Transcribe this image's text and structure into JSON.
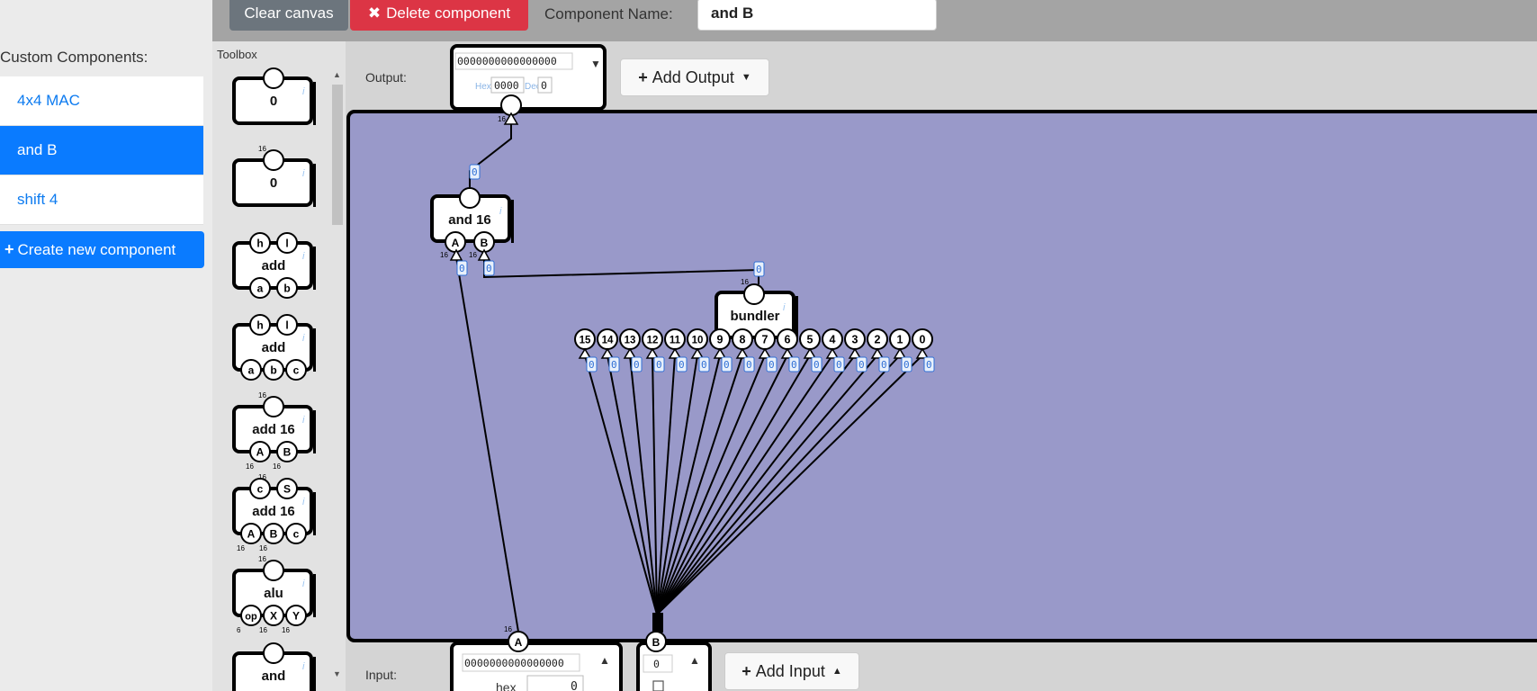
{
  "toolbar": {
    "clear_label": "Clear canvas",
    "delete_label": "Delete component",
    "delete_icon": "✖",
    "name_label": "Component Name:",
    "name_value": "and B"
  },
  "sidebar": {
    "title": "Custom Components:",
    "items": [
      {
        "label": "4x4 MAC",
        "active": false
      },
      {
        "label": "and B",
        "active": true
      },
      {
        "label": "shift 4",
        "active": false
      }
    ],
    "create_icon": "+",
    "create_label": "Create new component"
  },
  "toolbox": {
    "title": "Toolbox",
    "items": [
      {
        "label": "0",
        "width_tag": "",
        "inputs": [],
        "outputs": []
      },
      {
        "label": "0",
        "width_tag": "16",
        "inputs": [],
        "outputs": []
      },
      {
        "label": "add",
        "outputs": [
          "h",
          "l"
        ],
        "inputs": [
          "a",
          "b"
        ]
      },
      {
        "label": "add",
        "outputs": [
          "h",
          "l"
        ],
        "inputs": [
          "a",
          "b",
          "c"
        ]
      },
      {
        "label": "add 16",
        "outputs": [],
        "inputs": [
          "A",
          "B"
        ],
        "top_tag": "16",
        "in_tags": [
          "16",
          "16"
        ]
      },
      {
        "label": "add 16",
        "outputs": [
          "c",
          "S"
        ],
        "inputs": [
          "A",
          "B",
          "c"
        ],
        "top_tag": "16",
        "in_tags": [
          "16",
          "16"
        ]
      },
      {
        "label": "alu",
        "outputs": [],
        "inputs": [
          "op",
          "X",
          "Y"
        ],
        "top_tag": "16",
        "in_tags": [
          "6",
          "16",
          "16"
        ]
      },
      {
        "label": "and",
        "outputs": [],
        "inputs": []
      }
    ],
    "info_icon": "i"
  },
  "output": {
    "label": "Output:",
    "bits": "0000000000000000",
    "hex_label": "Hex",
    "hex_value": "0000",
    "dec_label": "Dec",
    "dec_value": "0",
    "width": "16",
    "add_label": "Add Output",
    "add_icon": "+"
  },
  "input": {
    "label": "Input:",
    "pins": [
      {
        "name": "A",
        "bits": "0000000000000000",
        "hex_label": "hex",
        "hex_value": "0",
        "width": "16"
      },
      {
        "name": "B",
        "bits": "0"
      }
    ],
    "add_label": "Add Input",
    "add_icon": "+"
  },
  "circuit": {
    "and16": {
      "label": "and 16",
      "inputs": [
        "A",
        "B"
      ],
      "in_tags": [
        "16",
        "16"
      ],
      "out_value": "0",
      "in_values": [
        "0",
        "0"
      ]
    },
    "bundler": {
      "label": "bundler",
      "width": "16",
      "out_value": "0",
      "inputs": [
        "15",
        "14",
        "13",
        "12",
        "11",
        "10",
        "9",
        "8",
        "7",
        "6",
        "5",
        "4",
        "3",
        "2",
        "1",
        "0"
      ],
      "in_value": "0"
    }
  },
  "colors": {
    "canvas": "#9999c9",
    "primary": "#0a7bff",
    "danger": "#dc3545",
    "secondary": "#6c757d",
    "wire": "#000000",
    "value_tag": "#2f6fd6"
  }
}
